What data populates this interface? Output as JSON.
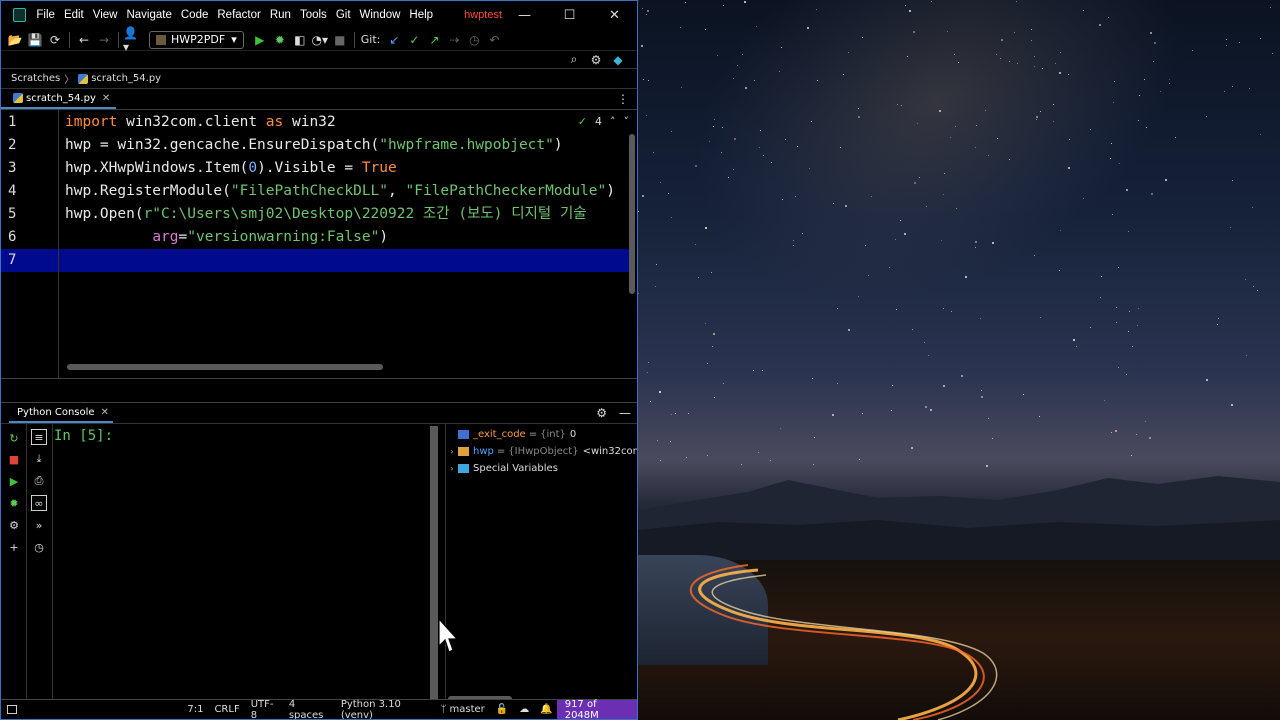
{
  "window": {
    "menu": [
      "File",
      "Edit",
      "View",
      "Navigate",
      "Code",
      "Refactor",
      "Run",
      "Tools",
      "Git",
      "Window",
      "Help"
    ],
    "project": "hwptest",
    "controls": {
      "minimize": "—",
      "maximize": "☐",
      "close": "✕"
    }
  },
  "toolbar": {
    "run_config": "HWP2PDF",
    "git_label": "Git:"
  },
  "breadcrumb": {
    "root": "Scratches",
    "file": "scratch_54.py"
  },
  "editor_tab": {
    "label": "scratch_54.py",
    "close": "✕"
  },
  "editor": {
    "line_numbers": [
      "1",
      "2",
      "3",
      "4",
      "5",
      "6",
      "7"
    ],
    "inspection_count": "4",
    "lines": [
      {
        "segments": [
          [
            "kw",
            "import"
          ],
          [
            "",
            " win32com.client "
          ],
          [
            "kw",
            "as"
          ],
          [
            "",
            " win32"
          ]
        ]
      },
      {
        "segments": [
          [
            "",
            "hwp = win32.gencache.EnsureDispatch("
          ],
          [
            "str",
            "\"hwpframe.hwpobject\""
          ],
          [
            "",
            ")"
          ]
        ]
      },
      {
        "segments": [
          [
            "",
            "hwp.XHwpWindows.Item("
          ],
          [
            "num",
            "0"
          ],
          [
            "",
            ").Visible = "
          ],
          [
            "kw",
            "True"
          ]
        ]
      },
      {
        "segments": [
          [
            "",
            "hwp.RegisterModule("
          ],
          [
            "str",
            "\"FilePathCheckDLL\""
          ],
          [
            "",
            ", "
          ],
          [
            "str",
            "\"FilePathCheckerModule\""
          ],
          [
            "",
            ")"
          ]
        ]
      },
      {
        "segments": [
          [
            "",
            "hwp.Open("
          ],
          [
            "str",
            "r\"C:\\Users\\smj02\\Desktop\\220922 조간 (보도) 디지털 기술"
          ]
        ]
      },
      {
        "segments": [
          [
            "",
            "          "
          ],
          [
            "param",
            "arg"
          ],
          [
            "",
            "="
          ],
          [
            "str",
            "\"versionwarning:False\""
          ],
          [
            "",
            ")"
          ]
        ]
      },
      {
        "segments": [
          [
            "",
            ""
          ]
        ]
      }
    ]
  },
  "console": {
    "tab_label": "Python Console",
    "close": "✕",
    "prompt": "In [5]:",
    "variables": [
      {
        "expander": "",
        "name": "_exit_code",
        "eq": "=",
        "type": "{int}",
        "value": "0"
      },
      {
        "expander": "›",
        "name": "hwp",
        "eq": "=",
        "type": "{IHwpObject}",
        "value": "<win32com"
      },
      {
        "expander": "›",
        "name": "Special Variables",
        "eq": "",
        "type": "",
        "value": ""
      }
    ]
  },
  "statusbar": {
    "position": "7:1",
    "line_sep": "CRLF",
    "encoding": "UTF-8",
    "indent": "4 spaces",
    "interpreter": "Python 3.10 (venv)",
    "branch": "master",
    "memory": "917 of 2048M"
  },
  "colors": {
    "accent": "#4a88c7",
    "keyword": "#ff8c3b",
    "string": "#6fc36f",
    "number": "#7fb3ff",
    "current_line": "#000a8c",
    "memory_bar": "#6b2fb3",
    "project_title": "#ff4a3f"
  }
}
